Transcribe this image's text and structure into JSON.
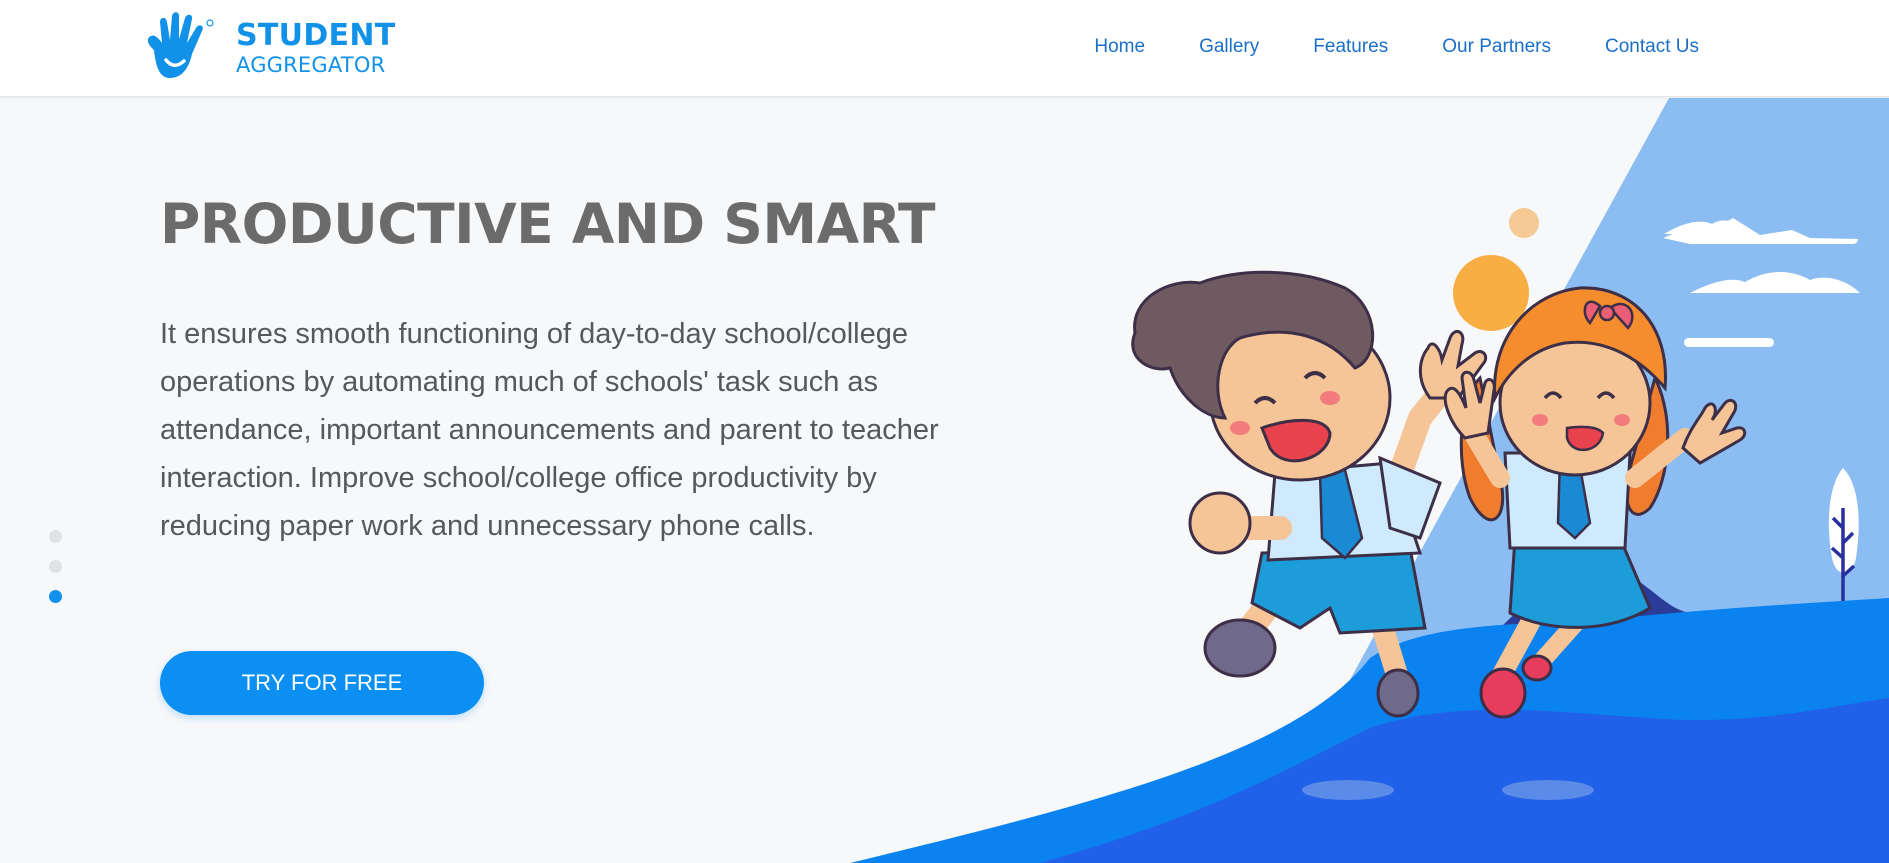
{
  "brand": {
    "name_line1": "STUDENT",
    "name_line2": "AGGREGATOR",
    "logo_icon": "waving-hand-logo-icon"
  },
  "nav": {
    "items": [
      {
        "label": "Home"
      },
      {
        "label": "Gallery"
      },
      {
        "label": "Features"
      },
      {
        "label": "Our Partners"
      },
      {
        "label": "Contact Us"
      }
    ]
  },
  "hero": {
    "title": "PRODUCTIVE AND SMART",
    "description": "It ensures smooth functioning of day-to-day school/college operations by automating much of schools' task such as attendance, important announcements and parent to teacher interaction. Improve school/college office productivity by reducing paper work and unnecessary phone calls.",
    "cta_label": "TRY FOR FREE",
    "slides": {
      "count": 3,
      "active_index": 2
    },
    "illustration": "two-students-jumping-illustration"
  },
  "colors": {
    "brand_blue": "#1291e8",
    "nav_link": "#1a6fc9",
    "cta_blue": "#0b8ff2",
    "headline_gray": "#6b6b6b",
    "text_gray": "#55585c",
    "sky_blue": "#8bbdf3",
    "wave_blue": "#0a82f0",
    "deep_blue": "#2160e8"
  }
}
